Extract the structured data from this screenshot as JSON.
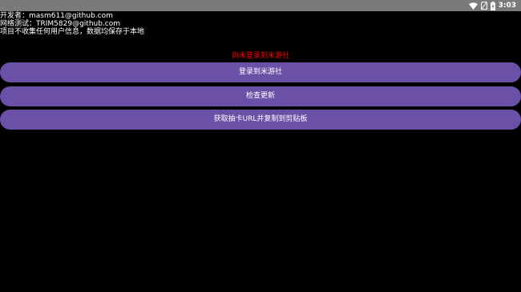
{
  "status_bar": {
    "time": "3:03",
    "icons": [
      "wifi-icon",
      "no-sim-icon",
      "battery-charging-icon"
    ]
  },
  "info": {
    "developer": "开发者：masm611@github.com",
    "network_test": "网络测试：TRIM5829@github.com",
    "privacy": "项目不收集任何用户信息，数据均保存于本地"
  },
  "login_status": "尚未登录到米游社",
  "buttons": {
    "login": "登录到米游社",
    "check_update": "检查更新",
    "get_gacha_url": "获取抽卡URL并复制到剪贴板"
  },
  "colors": {
    "button": "#6a50a7",
    "status_text": "#ff0000",
    "background": "#000000",
    "status_bar": "#7a7a7a"
  }
}
